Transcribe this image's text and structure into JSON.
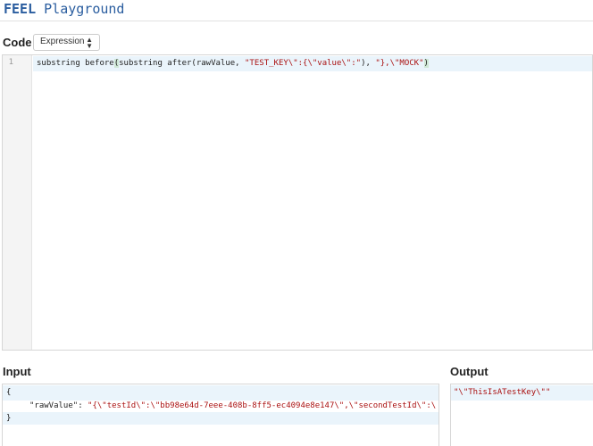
{
  "header": {
    "title_bold": "FEEL",
    "title_rest": " Playground"
  },
  "code": {
    "label": "Code",
    "mode": "Expression",
    "mode_caret": "▲▼",
    "line_number": "1",
    "expression": {
      "fn1": "substring before",
      "open1": "(",
      "fn2": "substring after(rawValue, ",
      "arg1": "\"TEST_KEY\\\":{\\\"value\\\":\"",
      "sep1": "), ",
      "arg2": "\"},\\\"MOCK\"",
      "close1": ")"
    }
  },
  "input": {
    "label": "Input",
    "line1": "{",
    "key": "\"rawValue\"",
    "colon": ": ",
    "value": "\"{\\\"testId\\\":\\\"bb98e64d-7eee-408b-8ff5-ec4094e8e147\\\",\\\"secondTestId\\\":\\",
    "line3": "}"
  },
  "output": {
    "label": "Output",
    "value": "\"\\\"ThisIsATestKey\\\"\""
  }
}
